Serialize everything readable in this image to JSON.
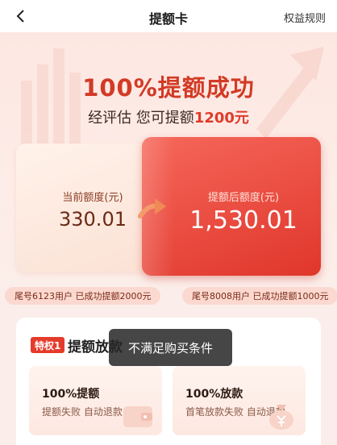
{
  "header": {
    "title": "提额卡",
    "rules_label": "权益规则",
    "back_icon": "chevron-left-icon"
  },
  "hero": {
    "headline": "100%提额成功",
    "subline_prefix": "经评估 您可提额",
    "subline_amount": "1200元"
  },
  "quota": {
    "current_label": "当前额度(元)",
    "current_value": "330.01",
    "after_label": "提额后额度(元)",
    "after_value": "1,530.01"
  },
  "ticker": [
    "尾号6123用户 已成功提额2000元",
    "尾号8008用户 已成功提额1000元"
  ],
  "privilege": {
    "badge": "特权1",
    "title": "提额放款",
    "features": [
      {
        "title": "100%提额",
        "desc": "提额失败 自动退款",
        "icon": "wallet-icon"
      },
      {
        "title": "100%放款",
        "desc": "首笔放款失败 自动退款",
        "icon": "money-bag-icon"
      }
    ]
  },
  "toast": {
    "message": "不满足购买条件"
  },
  "colors": {
    "accent": "#e53b2b",
    "headline": "#d23a25",
    "background": "#fbeeea"
  }
}
